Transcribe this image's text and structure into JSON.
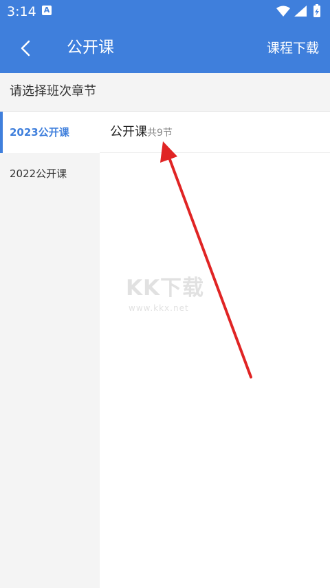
{
  "status_bar": {
    "time": "3:14",
    "notification_badge": "A"
  },
  "app_bar": {
    "title": "公开课",
    "download_label": "课程下载"
  },
  "prompt": {
    "text": "请选择班次章节"
  },
  "sidebar": {
    "tabs": [
      {
        "label": "2023公开课",
        "active": true
      },
      {
        "label": "2022公开课",
        "active": false
      }
    ]
  },
  "content": {
    "items": [
      {
        "name": "公开课",
        "count": "共9节"
      }
    ]
  },
  "watermark": {
    "logo": "KK下载",
    "url": "www.kkx.net"
  },
  "colors": {
    "primary": "#3f7fdc",
    "annotation_arrow": "#e02424"
  }
}
